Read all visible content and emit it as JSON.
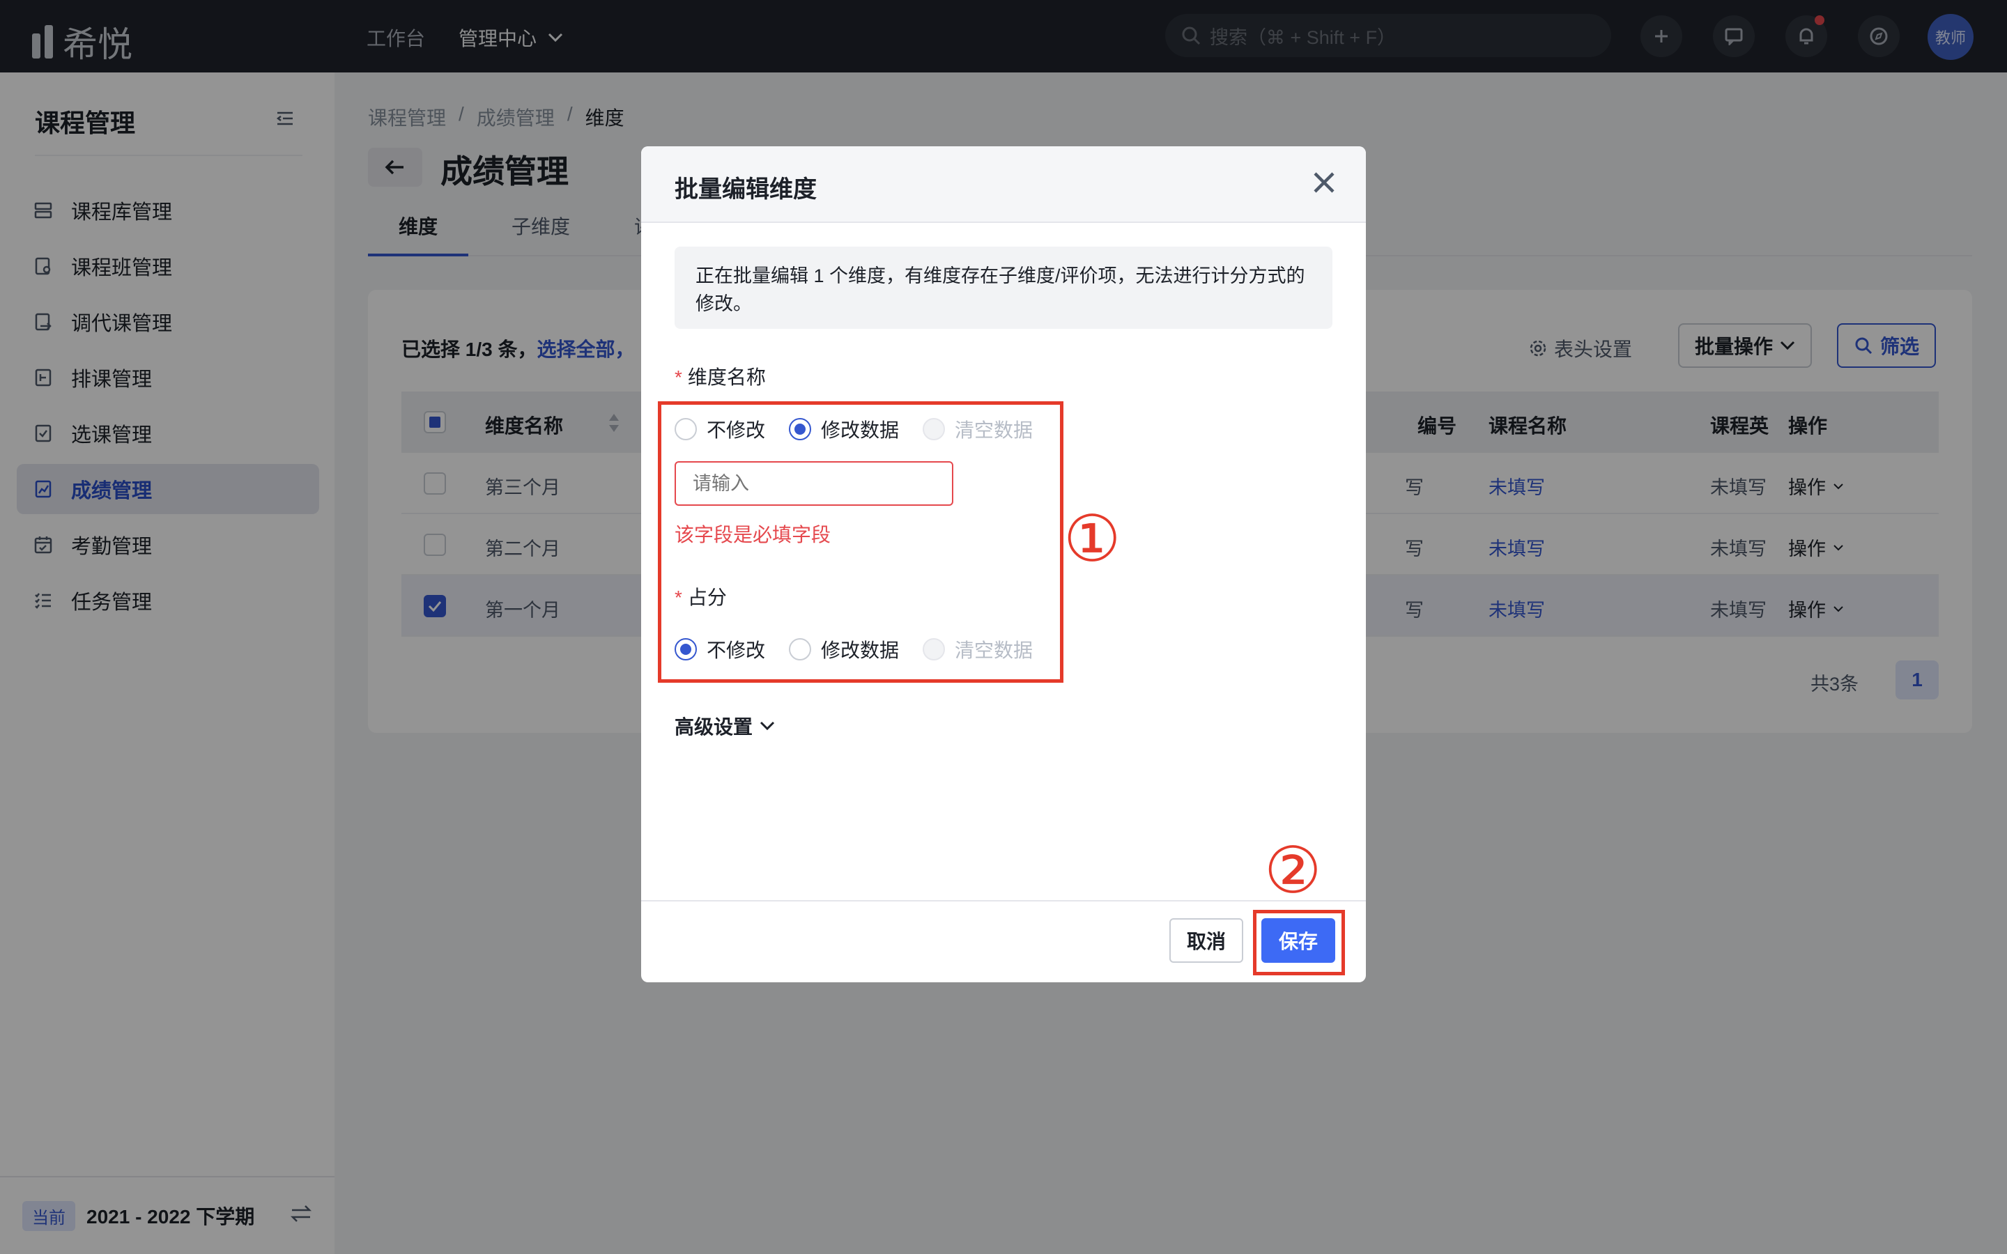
{
  "topbar": {
    "brand": "希悦",
    "nav": [
      "工作台",
      "管理中心"
    ],
    "search_placeholder": "搜索（⌘ + Shift + F）",
    "avatar_label": "教师"
  },
  "sidebar": {
    "title": "课程管理",
    "items": [
      {
        "label": "课程库管理",
        "icon": "library-icon"
      },
      {
        "label": "课程班管理",
        "icon": "class-icon"
      },
      {
        "label": "调代课管理",
        "icon": "swap-class-icon"
      },
      {
        "label": "排课管理",
        "icon": "schedule-icon"
      },
      {
        "label": "选课管理",
        "icon": "select-course-icon"
      },
      {
        "label": "成绩管理",
        "icon": "grade-icon"
      },
      {
        "label": "考勤管理",
        "icon": "calendar-icon"
      },
      {
        "label": "任务管理",
        "icon": "task-list-icon"
      }
    ],
    "active_index": 5,
    "footer": {
      "tag": "当前",
      "term": "2021 - 2022 下学期"
    }
  },
  "main": {
    "breadcrumb": [
      "课程管理",
      "成绩管理",
      "维度"
    ],
    "page_title": "成绩管理",
    "tabs": [
      "维度",
      "子维度",
      "评"
    ],
    "selection_text": "已选择 1/3 条，",
    "select_all": "选择全部，",
    "toolbar": {
      "columns": "表头设置",
      "batch": "批量操作",
      "filter": "筛选"
    },
    "columns": [
      "维度名称",
      "编号",
      "课程名称",
      "课程英",
      "操作"
    ],
    "rows": [
      {
        "name": "第三个月",
        "code": "写",
        "course": "未填写",
        "course_en": "未填写",
        "action": "操作",
        "checked": false
      },
      {
        "name": "第二个月",
        "code": "写",
        "course": "未填写",
        "course_en": "未填写",
        "action": "操作",
        "checked": false
      },
      {
        "name": "第一个月",
        "code": "写",
        "course": "未填写",
        "course_en": "未填写",
        "action": "操作",
        "checked": true
      }
    ],
    "total": "共3条",
    "page": "1"
  },
  "modal": {
    "title": "批量编辑维度",
    "notice": "正在批量编辑 1 个维度，有维度存在子维度/评价项，无法进行计分方式的修改。",
    "field1": {
      "label": "维度名称",
      "options": [
        "不修改",
        "修改数据",
        "清空数据"
      ],
      "selected": 1,
      "input_placeholder": "请输入",
      "error": "该字段是必填字段"
    },
    "field2": {
      "label": "占分",
      "options": [
        "不修改",
        "修改数据",
        "清空数据"
      ],
      "selected": 0
    },
    "advanced": "高级设置",
    "cancel": "取消",
    "save": "保存"
  },
  "annotations": [
    "①",
    "②"
  ],
  "colors": {
    "accent": "#3557cf",
    "primary_button": "#3d6af5",
    "error": "#e5484d",
    "annotation": "#e53a2a"
  }
}
